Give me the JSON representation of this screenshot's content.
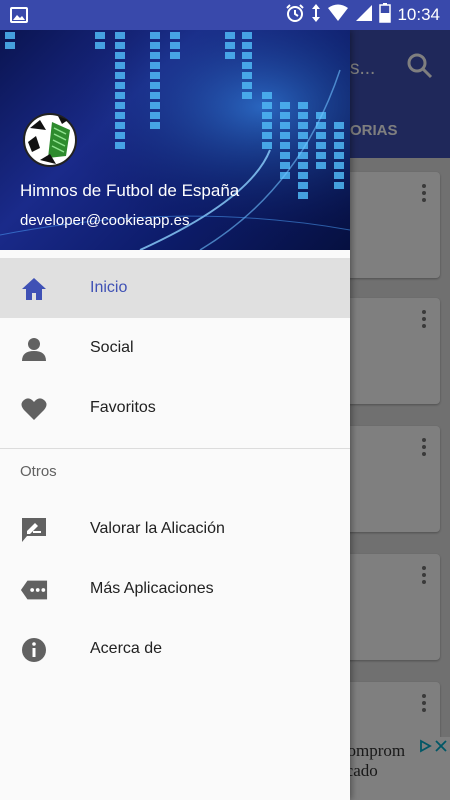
{
  "status_bar": {
    "time": "10:34",
    "icons": [
      "image-icon",
      "alarm-icon",
      "data-arrows-icon",
      "wifi-icon",
      "signal-icon",
      "battery-icon"
    ]
  },
  "background_app": {
    "title_fragment": "s...",
    "tab_fragment": "ORIAS",
    "ad": {
      "line1": "comprom",
      "line2": "rcado"
    },
    "colors": {
      "toolbar": "#3f51b5"
    }
  },
  "drawer": {
    "header": {
      "app_name": "Himnos de Futbol de España",
      "email": "developer@cookieapp.es"
    },
    "primary_items": [
      {
        "label": "Inicio",
        "icon": "home-icon",
        "active": true
      },
      {
        "label": "Social",
        "icon": "person-icon",
        "active": false
      },
      {
        "label": "Favoritos",
        "icon": "heart-icon",
        "active": false
      }
    ],
    "section_title": "Otros",
    "secondary_items": [
      {
        "label": "Valorar la Alicación",
        "icon": "rate-review-icon"
      },
      {
        "label": "Más Aplicaciones",
        "icon": "more-apps-icon"
      },
      {
        "label": "Acerca de",
        "icon": "info-icon"
      }
    ],
    "colors": {
      "accent": "#3f51b5",
      "active_bg": "#e0e0e0",
      "icon": "#616161"
    }
  }
}
